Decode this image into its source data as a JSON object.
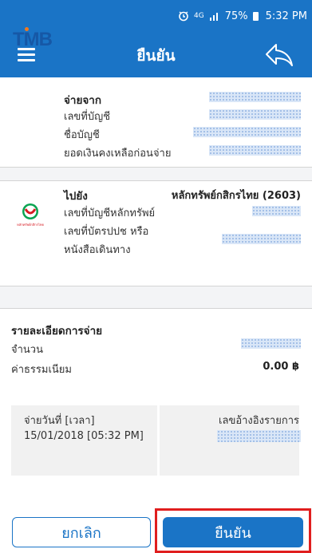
{
  "status_bar": {
    "network": "4G",
    "battery": "75%",
    "time": "5:32 PM"
  },
  "header": {
    "title": "ยืนยัน"
  },
  "from_section": {
    "title": "จ่ายจาก",
    "bank_logo_text": "TMB",
    "fields": [
      "เลขที่บัญชี",
      "ชื่อบัญชี",
      "ยอดเงินคงเหลือก่อนจ่าย"
    ]
  },
  "to_section": {
    "title": "ไปยัง",
    "payee_name": "หลักทรัพย์กสิกรไทย (2603)",
    "bank_logo_caption": "หลักทรัพย์กสิกรไทย",
    "fields": [
      "เลขที่บัญชีหลักทรัพย์",
      "เลขที่บัตรปปช หรือ",
      "หนังสือเดินทาง"
    ]
  },
  "details": {
    "title": "รายละเอียดการจ่าย",
    "amount_label": "จำนวน",
    "fee_label": "ค่าธรรมเนียม",
    "fee_value": "0.00 ฿",
    "date_label": "จ่ายวันที่ [เวลา]",
    "date_value": "15/01/2018 [05:32 PM]",
    "ref_label": "เลขอ้างอิงรายการ"
  },
  "buttons": {
    "cancel": "ยกเลิก",
    "confirm": "ยืนยัน"
  },
  "colors": {
    "primary": "#1a74c6",
    "highlight": "#e01e1e"
  }
}
